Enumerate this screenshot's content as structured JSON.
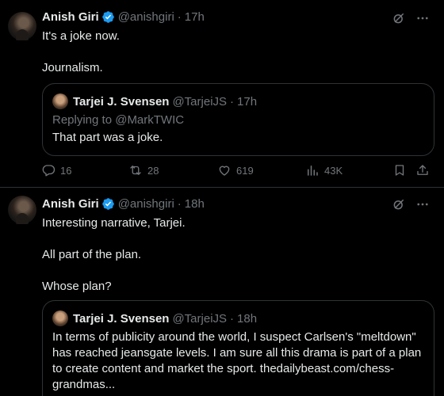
{
  "tweets": [
    {
      "author": "Anish Giri",
      "handle": "@anishgiri",
      "time": "17h",
      "body": [
        "It's a joke now.",
        "Journalism."
      ],
      "quote": {
        "author": "Tarjei J. Svensen",
        "handle": "@TarjeiJS",
        "time": "17h",
        "replying_to": "Replying to @MarkTWIC",
        "text": "That part was a joke."
      },
      "actions": {
        "replies": "16",
        "reposts": "28",
        "likes": "619",
        "views": "43K"
      }
    },
    {
      "author": "Anish Giri",
      "handle": "@anishgiri",
      "time": "18h",
      "body": [
        "Interesting narrative, Tarjei.",
        "All part of the plan.",
        "Whose plan?"
      ],
      "quote": {
        "author": "Tarjei J. Svensen",
        "handle": "@TarjeiJS",
        "time": "18h",
        "text": "In terms of publicity around the world, I suspect Carlsen's \"meltdown\" has reached jeansgate levels. I am sure all this drama is part of a plan to create content and market the sport. thedailybeast.com/chess-grandmas..."
      }
    }
  ],
  "sep": "·",
  "colors": {
    "background": "#000000",
    "text": "#e7e9ea",
    "muted": "#71767b",
    "verified": "#1d9bf0",
    "border": "#2f3336"
  },
  "icons": [
    "verified-badge-icon",
    "grok-icon",
    "more-icon",
    "reply-icon",
    "repost-icon",
    "like-icon",
    "views-icon",
    "bookmark-icon",
    "share-icon"
  ]
}
